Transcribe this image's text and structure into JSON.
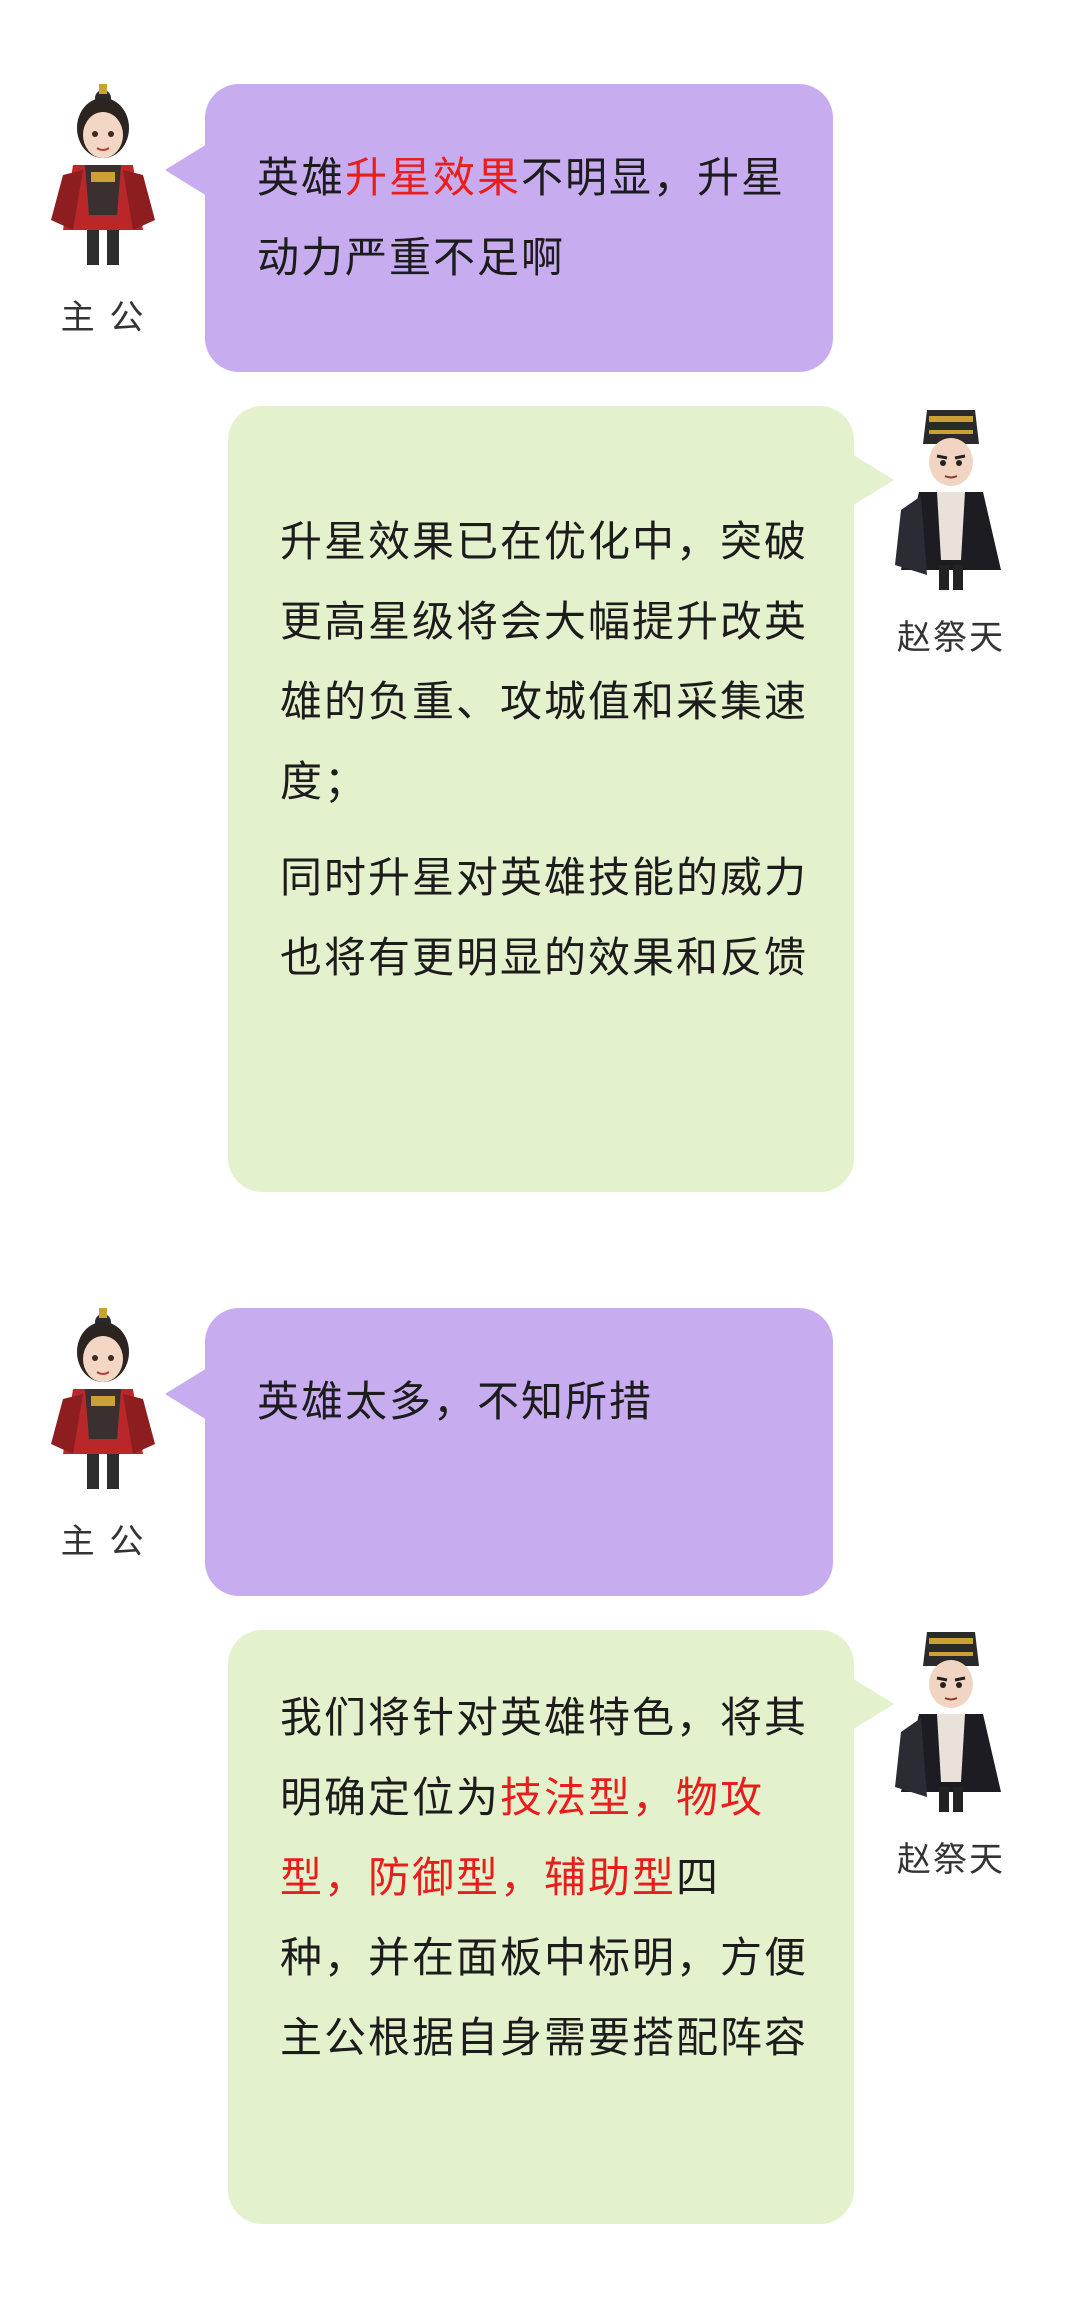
{
  "colors": {
    "lord_bubble": "#c7acef",
    "reply_bubble": "#e4f1cd",
    "highlight": "#ea1d1d",
    "text": "#1c1c1c"
  },
  "speakers": {
    "lord": "主 公",
    "dev": "赵祭天"
  },
  "messages": [
    {
      "speaker": "lord",
      "segments": [
        {
          "text": "英雄",
          "highlight": false
        },
        {
          "text": "升星效果",
          "highlight": true
        },
        {
          "text": "不明显，升星动力严重不足啊",
          "highlight": false
        }
      ]
    },
    {
      "speaker": "dev",
      "paragraphs": [
        "升星效果已在优化中，突破更高星级将会大幅提升改英雄的负重、攻城值和采集速度；",
        "同时升星对英雄技能的威力也将有更明显的效果和反馈"
      ]
    },
    {
      "speaker": "lord",
      "segments": [
        {
          "text": "英雄太多，不知所措",
          "highlight": false
        }
      ]
    },
    {
      "speaker": "dev",
      "segments": [
        {
          "text": "我们将针对英雄特色，将其明确定位为",
          "highlight": false
        },
        {
          "text": "技法型，物攻型，防御型，辅助型",
          "highlight": true
        },
        {
          "text": "四种，并在面板中标明，方便主公根据自身需要搭配阵容",
          "highlight": false
        }
      ]
    }
  ]
}
